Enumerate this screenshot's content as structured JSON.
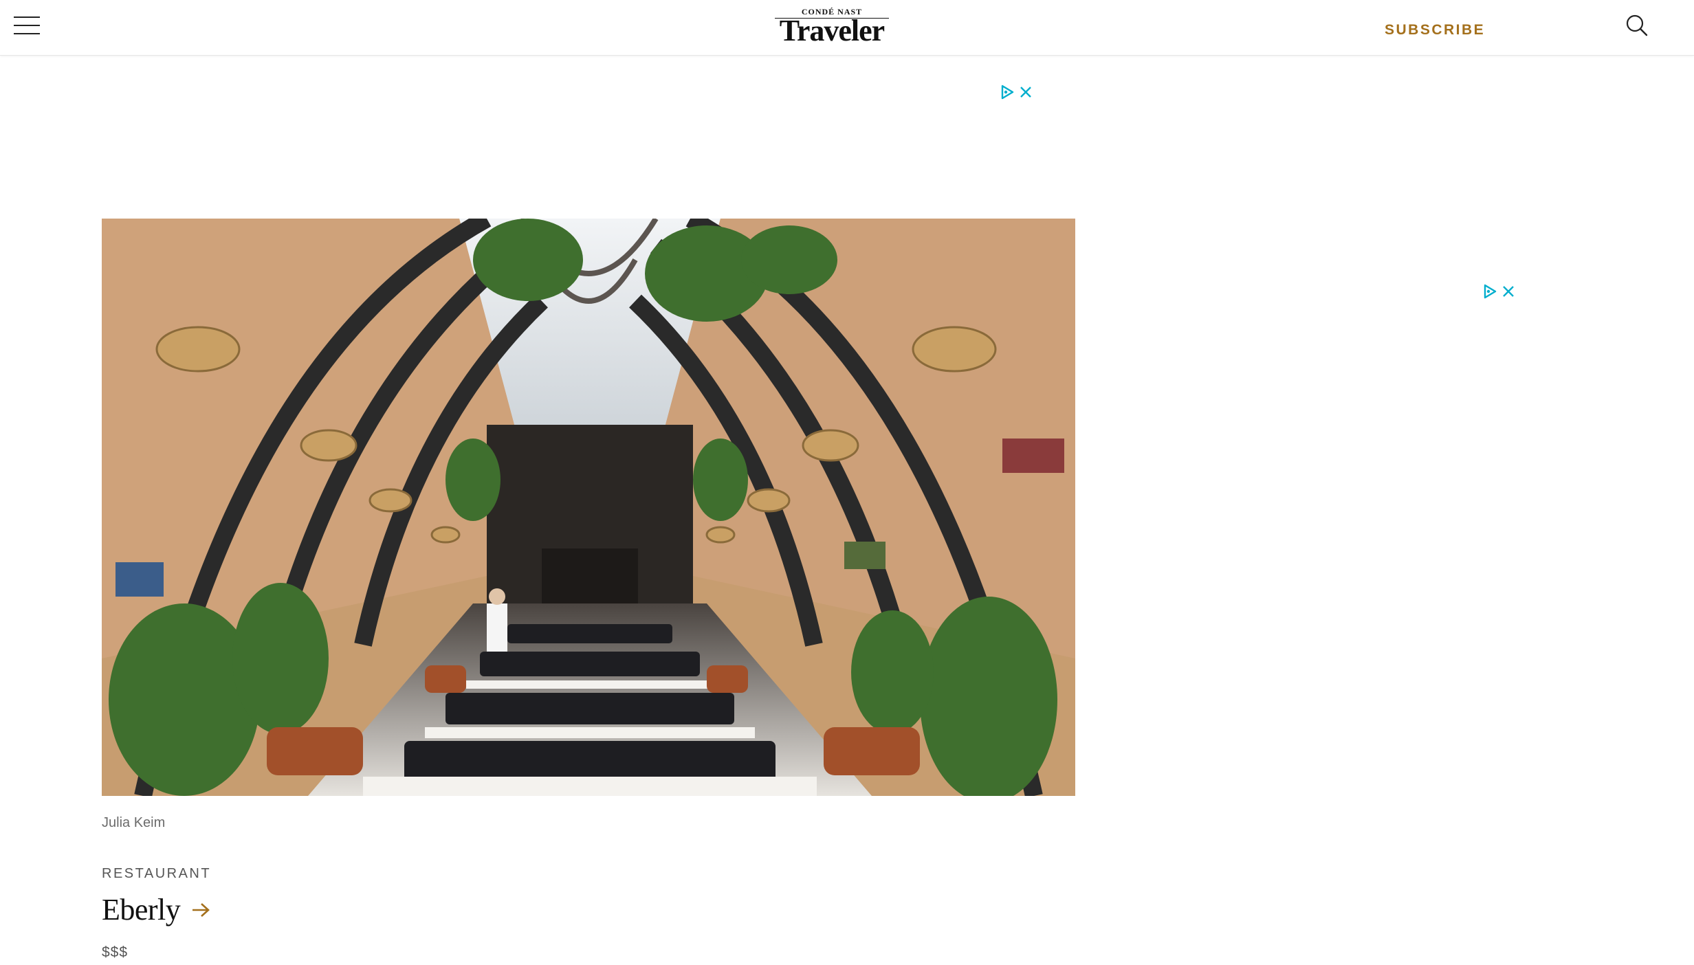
{
  "header": {
    "logo_top": "CONDÉ NAST",
    "logo_main": "Traveler",
    "subscribe_label": "SUBSCRIBE"
  },
  "icons": {
    "menu": "hamburger-menu-icon",
    "search": "search-icon",
    "adchoices": "adchoices-icon",
    "close": "close-icon"
  },
  "colors": {
    "accent": "#a4701c",
    "ad_marker": "#00aecd"
  },
  "article": {
    "photo_credit": "Julia Keim",
    "rubric": "RESTAURANT",
    "venue_name": "Eberly",
    "price": "$$$"
  }
}
